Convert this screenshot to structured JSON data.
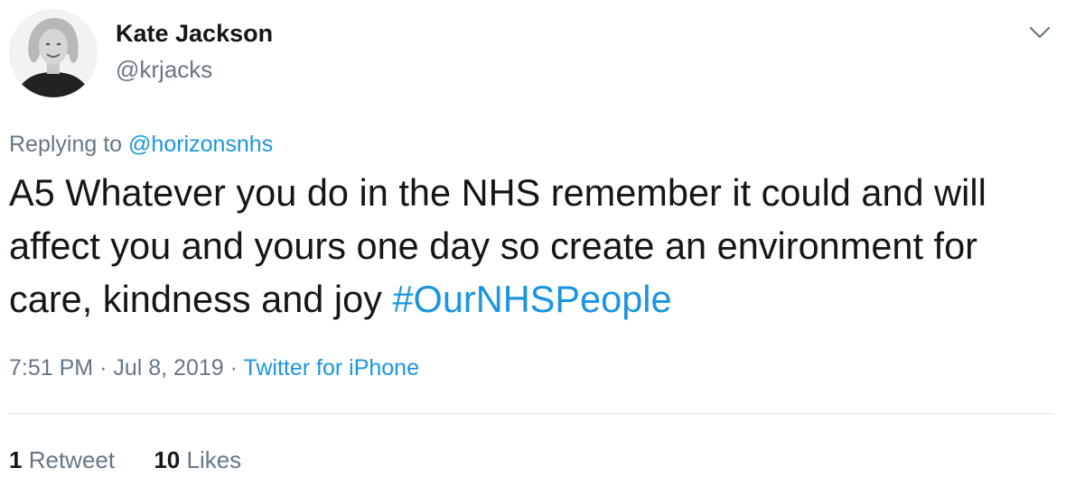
{
  "author": {
    "name": "Kate Jackson",
    "handle": "@krjacks"
  },
  "menu": {
    "icon": "chevron-down-icon"
  },
  "reply": {
    "prefix": "Replying to",
    "mention": "@horizonsnhs"
  },
  "tweet": {
    "text": "A5 Whatever you do in the NHS remember it could and will affect you and yours one day so create an environment for care, kindness and joy",
    "hashtag": "#OurNHSPeople"
  },
  "meta": {
    "time": "7:51 PM",
    "separator1": "·",
    "date": "Jul 8, 2019",
    "separator2": "·",
    "source": "Twitter for iPhone"
  },
  "stats": {
    "retweets_count": "1",
    "retweets_label": "Retweet",
    "likes_count": "10",
    "likes_label": "Likes"
  },
  "colors": {
    "link": "#1b95e0",
    "secondary_text": "#657786",
    "primary_text": "#14171a",
    "divider": "#e1e8ed"
  }
}
